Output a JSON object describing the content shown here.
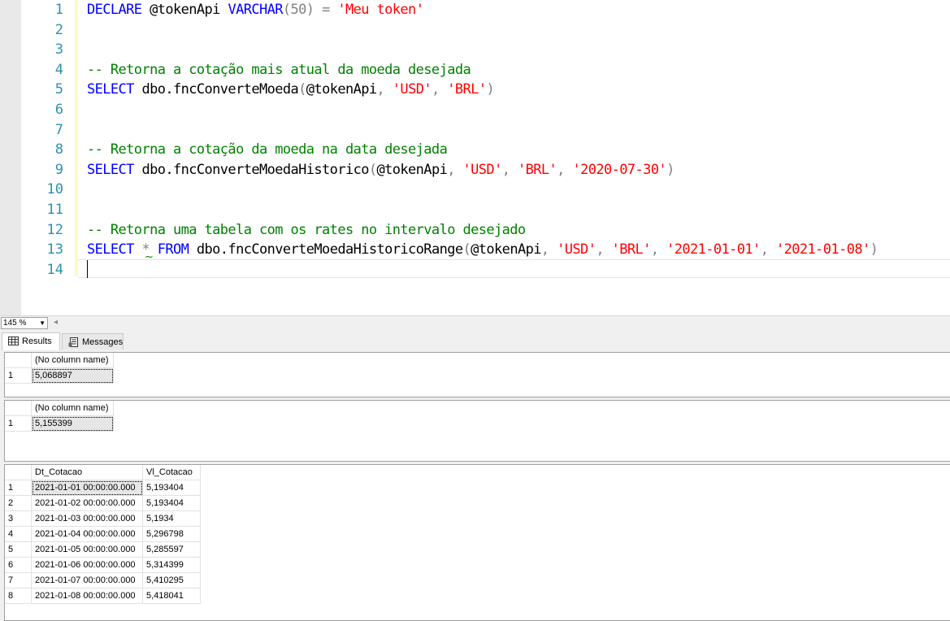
{
  "editor": {
    "line_numbers": [
      "1",
      "2",
      "3",
      "4",
      "5",
      "6",
      "7",
      "8",
      "9",
      "10",
      "11",
      "12",
      "13",
      "14"
    ],
    "lines": {
      "l1": {
        "kw1": "DECLARE",
        "var": " @tokenApi ",
        "kw2": "VARCHAR",
        "paren": "(50) = ",
        "str": "'Meu token'"
      },
      "l4": {
        "comment": "-- Retorna a cotação mais atual da moeda desejada"
      },
      "l5": {
        "kw": "SELECT",
        "fn": " dbo.fncConverteMoeda",
        "p1": "(",
        "arg": "@tokenApi",
        "c1": ", ",
        "s1": "'USD'",
        "c2": ", ",
        "s2": "'BRL'",
        "p2": ")"
      },
      "l8": {
        "comment": "-- Retorna a cotação da moeda na data desejada"
      },
      "l9": {
        "kw": "SELECT",
        "fn": " dbo.fncConverteMoedaHistorico",
        "p1": "(",
        "arg": "@tokenApi",
        "c1": ", ",
        "s1": "'USD'",
        "c2": ", ",
        "s2": "'BRL'",
        "c3": ", ",
        "s3": "'2020-07-30'",
        "p2": ")"
      },
      "l12": {
        "comment": "-- Retorna uma tabela com os rates no intervalo desejado"
      },
      "l13": {
        "kw1": "SELECT",
        "star": " * ",
        "kw2": "FROM",
        "fn": " dbo.fncConverteMoedaHistoricoRange",
        "p1": "(",
        "arg": "@tokenApi",
        "c1": ", ",
        "s1": "'USD'",
        "c2": ", ",
        "s2": "'BRL'",
        "c3": ", ",
        "s3": "'2021-01-01'",
        "c4": ", ",
        "s4": "'2021-01-08'",
        "p2": ")"
      }
    },
    "colors": {
      "keyword": "#0000ff",
      "string": "#ff0000",
      "comment": "#008000",
      "line_number": "#2b91af"
    }
  },
  "zoom": {
    "value": "145 %"
  },
  "tabs": {
    "results": "Results",
    "messages": "Messages"
  },
  "result1": {
    "header": "(No column name)",
    "row_num": "1",
    "value": "5,068897"
  },
  "result2": {
    "header": "(No column name)",
    "row_num": "1",
    "value": "5,155399"
  },
  "result3": {
    "headers": [
      "Dt_Cotacao",
      "Vl_Cotacao"
    ],
    "rows": [
      {
        "n": "1",
        "date": "2021-01-01 00:00:00.000",
        "val": "5,193404"
      },
      {
        "n": "2",
        "date": "2021-01-02 00:00:00.000",
        "val": "5,193404"
      },
      {
        "n": "3",
        "date": "2021-01-03 00:00:00.000",
        "val": "5,1934"
      },
      {
        "n": "4",
        "date": "2021-01-04 00:00:00.000",
        "val": "5,296798"
      },
      {
        "n": "5",
        "date": "2021-01-05 00:00:00.000",
        "val": "5,285597"
      },
      {
        "n": "6",
        "date": "2021-01-06 00:00:00.000",
        "val": "5,314399"
      },
      {
        "n": "7",
        "date": "2021-01-07 00:00:00.000",
        "val": "5,410295"
      },
      {
        "n": "8",
        "date": "2021-01-08 00:00:00.000",
        "val": "5,418041"
      }
    ]
  }
}
